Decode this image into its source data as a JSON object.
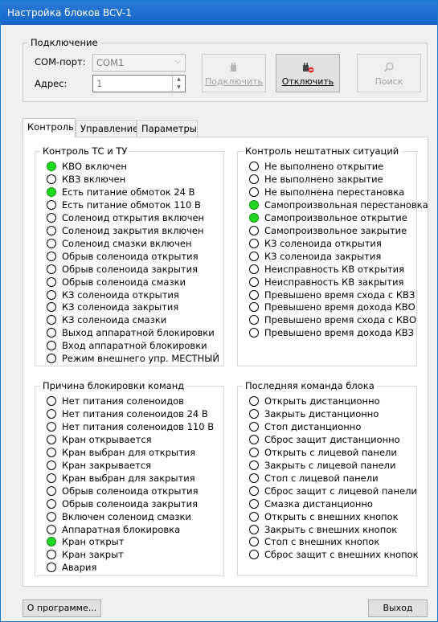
{
  "window": {
    "title": "Настройка блоков BCV-1"
  },
  "connection": {
    "group_title": "Подключение",
    "com_label": "COM-порт:",
    "com_value": "COM1",
    "address_label": "Адрес:",
    "address_value": "1",
    "connect_label": "Подключить",
    "disconnect_label": "Отключить",
    "search_label": "Поиск"
  },
  "tabs": [
    {
      "label": "Контроль"
    },
    {
      "label": "Управление"
    },
    {
      "label": "Параметры"
    }
  ],
  "status_colors": {
    "on": "#1ed91e",
    "off": "#ffffff",
    "disabled": "#b0b0b0"
  },
  "panels": {
    "control": {
      "title": "Контроль ТС и ТУ",
      "items": [
        {
          "label": "КВО включен",
          "state": "on"
        },
        {
          "label": "КВЗ включен",
          "state": "off"
        },
        {
          "label": "Есть питание обмоток 24 В",
          "state": "on"
        },
        {
          "label": "Есть питание обмоток 110 В",
          "state": "off"
        },
        {
          "label": "Соленоид открытия включен",
          "state": "off"
        },
        {
          "label": "Соленоид закрытия включен",
          "state": "off"
        },
        {
          "label": "Соленоид смазки включен",
          "state": "disabled"
        },
        {
          "label": "Обрыв соленоида открытия",
          "state": "off"
        },
        {
          "label": "Обрыв соленоида закрытия",
          "state": "off"
        },
        {
          "label": "Обрыв соленоида смазки",
          "state": "disabled"
        },
        {
          "label": "КЗ соленоида открытия",
          "state": "off"
        },
        {
          "label": "КЗ соленоида закрытия",
          "state": "off"
        },
        {
          "label": "КЗ соленоида смазки",
          "state": "disabled"
        },
        {
          "label": "Выход аппаратной блокировки",
          "state": "disabled"
        },
        {
          "label": "Вход аппаратной блокировки",
          "state": "disabled"
        },
        {
          "label": "Режим внешнего упр. МЕСТНЫЙ",
          "state": "off"
        }
      ]
    },
    "emergency": {
      "title": "Контроль нештатных ситуаций",
      "items": [
        {
          "label": "Не выполнено открытие",
          "state": "off"
        },
        {
          "label": "Не выполнено закрытие",
          "state": "off"
        },
        {
          "label": "Не выполнена перестановка",
          "state": "off"
        },
        {
          "label": "Самопроизвольная перестановка",
          "state": "on"
        },
        {
          "label": "Самопроизвольное открытие",
          "state": "on"
        },
        {
          "label": "Самопроизвольное закрытие",
          "state": "off"
        },
        {
          "label": "КЗ соленоида открытия",
          "state": "off"
        },
        {
          "label": "КЗ соленоида закрытия",
          "state": "off"
        },
        {
          "label": "Неисправность КВ открытия",
          "state": "off"
        },
        {
          "label": "Неисправность КВ закрытия",
          "state": "off"
        },
        {
          "label": "Превышено время схода с КВЗ",
          "state": "off"
        },
        {
          "label": "Превышено время дохода КВО",
          "state": "off"
        },
        {
          "label": "Превышено время схода с КВО",
          "state": "off"
        },
        {
          "label": "Превышено время дохода КВЗ",
          "state": "off"
        }
      ]
    },
    "block_reason": {
      "title": "Причина блокировки команд",
      "items": [
        {
          "label": "Нет питания соленоидов",
          "state": "off"
        },
        {
          "label": "Нет питания соленоидов 24 В",
          "state": "off"
        },
        {
          "label": "Нет питания соленоидов 110 В",
          "state": "off"
        },
        {
          "label": "Кран открывается",
          "state": "off"
        },
        {
          "label": "Кран выбран для открытия",
          "state": "off"
        },
        {
          "label": "Кран закрывается",
          "state": "off"
        },
        {
          "label": "Кран выбран для закрытия",
          "state": "off"
        },
        {
          "label": "Обрыв соленоида открытия",
          "state": "off"
        },
        {
          "label": "Обрыв соленоида закрытия",
          "state": "off"
        },
        {
          "label": "Включен соленоид смазки",
          "state": "disabled"
        },
        {
          "label": "Аппаратная блокировка",
          "state": "disabled"
        },
        {
          "label": "Кран открыт",
          "state": "on"
        },
        {
          "label": "Кран закрыт",
          "state": "off"
        },
        {
          "label": "Авария",
          "state": "off"
        }
      ]
    },
    "last_command": {
      "title": "Последняя команда блока",
      "items": [
        {
          "label": "Открыть дистанционно",
          "state": "off"
        },
        {
          "label": "Закрыть дистанционно",
          "state": "off"
        },
        {
          "label": "Стоп дистанционно",
          "state": "off"
        },
        {
          "label": "Сброс защит дистанционно",
          "state": "off"
        },
        {
          "label": "Открыть с лицевой панели",
          "state": "off"
        },
        {
          "label": "Закрыть с лицевой панели",
          "state": "off"
        },
        {
          "label": "Стоп с лицевой панели",
          "state": "off"
        },
        {
          "label": "Сброс защит с лицевой панели",
          "state": "off"
        },
        {
          "label": "Смазка дистанционно",
          "state": "disabled"
        },
        {
          "label": "Открыть с внешних кнопок",
          "state": "off"
        },
        {
          "label": "Закрыть с внешних кнопок",
          "state": "off"
        },
        {
          "label": "Стоп с внешних кнопок",
          "state": "off"
        },
        {
          "label": "Сброс защит с внешних кнопок",
          "state": "off"
        }
      ]
    }
  },
  "footer": {
    "about_label": "О программе...",
    "exit_label": "Выход"
  }
}
